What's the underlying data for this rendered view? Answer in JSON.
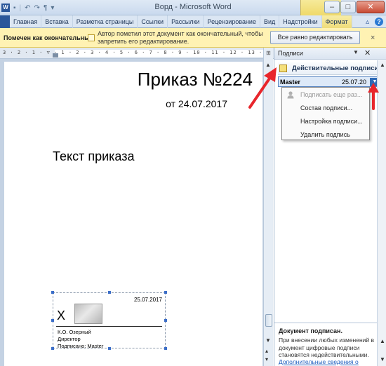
{
  "window": {
    "title": "Ворд - Microsoft Word",
    "pilcrow": "¶"
  },
  "ribbon": {
    "tabs": [
      "Главная",
      "Вставка",
      "Разметка страницы",
      "Ссылки",
      "Рассылки",
      "Рецензирование",
      "Вид",
      "Надстройки",
      "Формат"
    ]
  },
  "message_bar": {
    "title": "Помечен как окончательный",
    "text": "Автор пометил этот документ как окончательный, чтобы запретить его редактирование.",
    "button": "Все равно редактировать",
    "close": "×"
  },
  "document": {
    "title": "Приказ №224",
    "date": "от 24.07.2017",
    "body": "Текст приказа",
    "signature_line": {
      "date": "25.07.2017",
      "x": "X",
      "name": "К.О. Озерный",
      "position": "Директор",
      "signed_by": "Подписано: Master"
    }
  },
  "signatures_pane": {
    "title": "Подписи",
    "valid_header": "Действительные подписи",
    "entry": {
      "name": "Master",
      "date": "25.07.20"
    },
    "menu": [
      "Подписать еще раз...",
      "Состав подписи...",
      "Настройка подписи...",
      "Удалить подпись"
    ],
    "footer_title": "Документ подписан.",
    "footer_text": "При внесении любых изменений в документ цифровые подписи становятся недействительными.",
    "footer_link": "Дополнительные сведения о"
  },
  "colors": {
    "message_bar": "#fff2b3",
    "accent": "#2b579a",
    "annotation_arrow": "#e8262c"
  }
}
